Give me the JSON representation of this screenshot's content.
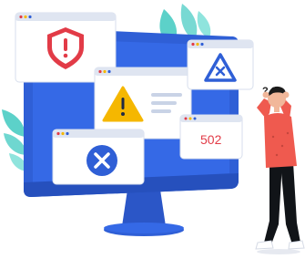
{
  "illustration": {
    "error_popup": {
      "code_text": "502"
    },
    "question_marks": "? ?",
    "colors": {
      "monitor_frame": "#2f5fd6",
      "monitor_screen": "#3569e6",
      "stand": "#2b56c7",
      "window_bar": "#dfe5f1",
      "window_body": "#ffffff",
      "shield": "#e23b47",
      "warning": "#f5b700",
      "close_circle": "#2f5fd6",
      "error_text": "#e23b47",
      "leaves": "#3fc9c0",
      "person_shirt": "#ef5a4f",
      "person_pants": "#111418",
      "person_skin": "#f1b79a",
      "person_hair": "#1b1b1b"
    },
    "icons": {
      "shield": "shield-alert-icon",
      "warning": "warning-triangle-icon",
      "close": "close-circle-icon",
      "alert": "triangle-x-icon"
    }
  }
}
